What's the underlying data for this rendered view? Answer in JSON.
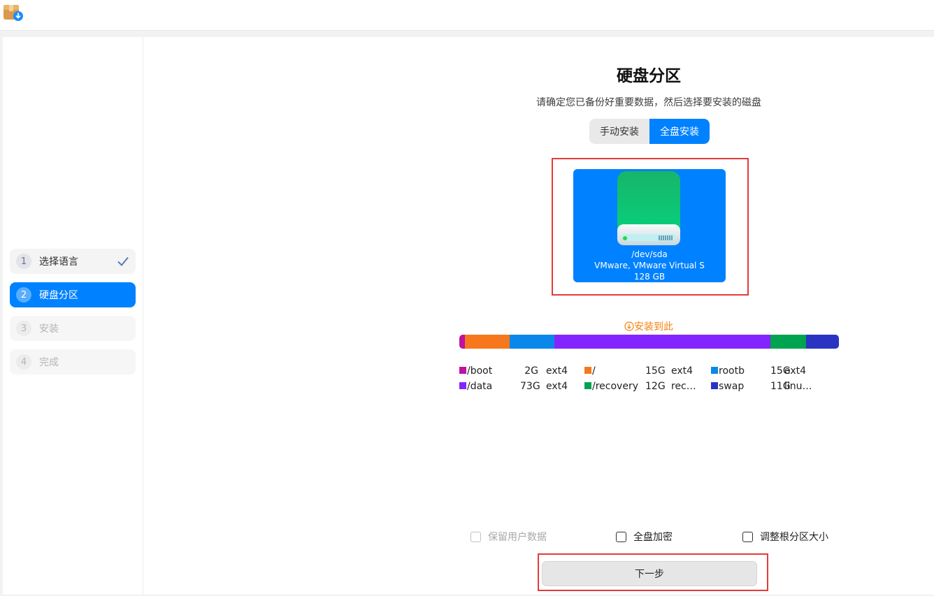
{
  "sidebar": {
    "steps": [
      {
        "num": "1",
        "label": "选择语言",
        "state": "done"
      },
      {
        "num": "2",
        "label": "硬盘分区",
        "state": "active"
      },
      {
        "num": "3",
        "label": "安装",
        "state": "disabled"
      },
      {
        "num": "4",
        "label": "完成",
        "state": "disabled"
      }
    ]
  },
  "main": {
    "title": "硬盘分区",
    "subtitle": "请确定您已备份好重要数据，然后选择要安装的磁盘",
    "mode_tabs": [
      {
        "label": "手动安装",
        "selected": false
      },
      {
        "label": "全盘安装",
        "selected": true
      }
    ],
    "disk": {
      "device": "/dev/sda",
      "model": "VMware, VMware Virtual S",
      "size": "128 GB",
      "icon": "hard-drive-icon"
    },
    "install_here_label": "安装到此",
    "partitions": [
      {
        "name": "/boot",
        "size": "2G",
        "fs": "ext4",
        "color": "#c0119f",
        "size_gb": 2
      },
      {
        "name": "/",
        "size": "15G",
        "fs": "ext4",
        "color": "#f7771d",
        "size_gb": 15
      },
      {
        "name": "rootb",
        "size": "15G",
        "fs": "ext4",
        "color": "#0a88ea",
        "size_gb": 15
      },
      {
        "name": "/data",
        "size": "73G",
        "fs": "ext4",
        "color": "#8425ff",
        "size_gb": 73
      },
      {
        "name": "/recovery",
        "size": "12G",
        "fs": "rec…",
        "color": "#00a350",
        "size_gb": 12
      },
      {
        "name": "swap",
        "size": "11G",
        "fs": "linu…",
        "color": "#2a34c3",
        "size_gb": 11
      }
    ],
    "options": {
      "keep_user_data": {
        "label": "保留用户数据",
        "checked": false,
        "disabled": true
      },
      "full_disk_encryption": {
        "label": "全盘加密",
        "checked": false
      },
      "resize_root": {
        "label": "调整根分区大小",
        "checked": false
      }
    },
    "next_label": "下一步"
  },
  "colors": {
    "accent": "#0081ff",
    "warning": "#f77f0a",
    "highlight": "#e23b3b"
  }
}
